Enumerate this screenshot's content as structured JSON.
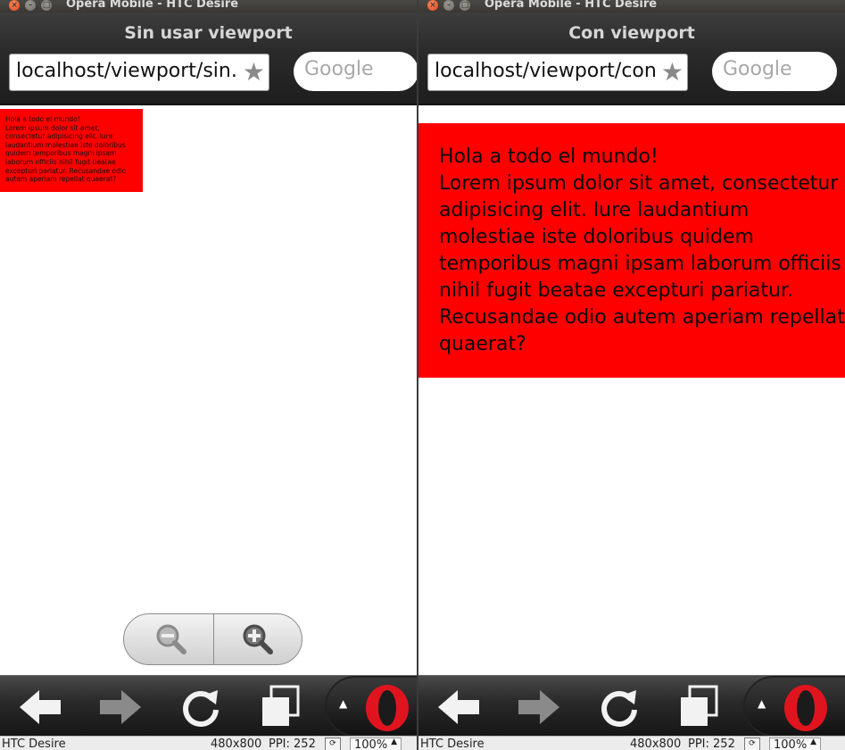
{
  "windows": [
    {
      "window_title": "Opera Mobile - HTC Desire",
      "page_title": "Sin usar viewport",
      "url": "localhost/viewport/sin.",
      "search_placeholder": "Google",
      "content_heading": "Hola a todo el mundo!",
      "content_body": "Lorem ipsum dolor sit amet, consectetur adipisicing elit. Iure laudantium molestiae iste doloribus quidem temporibus magni ipsam laborum officiis nihil fugit beatae excepturi pariatur. Recusandae odio autem aperiam repellat quaerat?",
      "status": {
        "device": "HTC Desire",
        "resolution": "480x800",
        "ppi": "PPI: 252",
        "zoom": "100%"
      }
    },
    {
      "window_title": "Opera Mobile - HTC Desire",
      "page_title": "Con viewport",
      "url": "localhost/viewport/con",
      "search_placeholder": "Google",
      "content_heading": "Hola a todo el mundo!",
      "content_body": "Lorem ipsum dolor sit amet, consectetur adipisicing elit. Iure laudantium molestiae iste doloribus quidem temporibus magni ipsam laborum officiis nihil fugit beatae excepturi pariatur. Recusandae odio autem aperiam repellat quaerat?",
      "status": {
        "device": "HTC Desire",
        "resolution": "480x800",
        "ppi": "PPI: 252",
        "zoom": "100%"
      }
    }
  ],
  "colors": {
    "content_box": "#ff0000",
    "opera_red": "#e0141e",
    "toolbar_dark": "#1e1e1e"
  },
  "icons": [
    "close-icon",
    "minimize-icon",
    "maximize-icon",
    "star-icon",
    "zoom-out-icon",
    "zoom-in-icon",
    "back-arrow-icon",
    "forward-arrow-icon",
    "reload-icon",
    "tabs-icon",
    "opera-logo-icon",
    "chevron-up-icon",
    "rotate-icon"
  ]
}
